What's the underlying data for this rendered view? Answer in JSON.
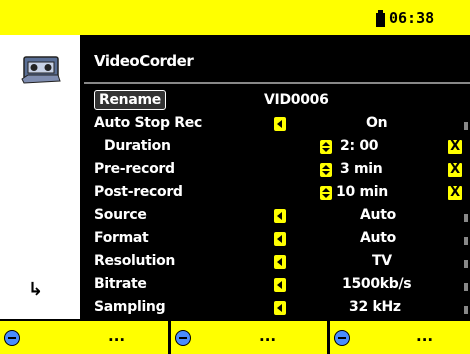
{
  "status": {
    "time": "06:38"
  },
  "app": {
    "title": "VideoCorder"
  },
  "settings": [
    {
      "label": "Rename",
      "value": "VID0006",
      "type": "button"
    },
    {
      "label": "Auto Stop Rec",
      "value": "On",
      "control": "left-arrow"
    },
    {
      "label": "Duration",
      "value": "2: 00",
      "control": "up-down",
      "indent": true,
      "check": "X"
    },
    {
      "label": "Pre-record",
      "value": "3 min",
      "control": "up-down",
      "check": "X"
    },
    {
      "label": "Post-record",
      "value": "10 min",
      "control": "up-down",
      "check": "X"
    },
    {
      "label": "Source",
      "value": "Auto",
      "control": "left-arrow"
    },
    {
      "label": "Format",
      "value": "Auto",
      "control": "left-arrow"
    },
    {
      "label": "Resolution",
      "value": "TV",
      "control": "left-arrow"
    },
    {
      "label": "Bitrate",
      "value": "1500kb/s",
      "control": "left-arrow"
    },
    {
      "label": "Sampling",
      "value": "32 kHz",
      "control": "left-arrow"
    }
  ],
  "softkeys": [
    {
      "label": "..."
    },
    {
      "label": "..."
    },
    {
      "label": "..."
    }
  ],
  "colors": {
    "accent": "#ffff00",
    "background": "#000000",
    "sidebar": "#ffffff"
  }
}
